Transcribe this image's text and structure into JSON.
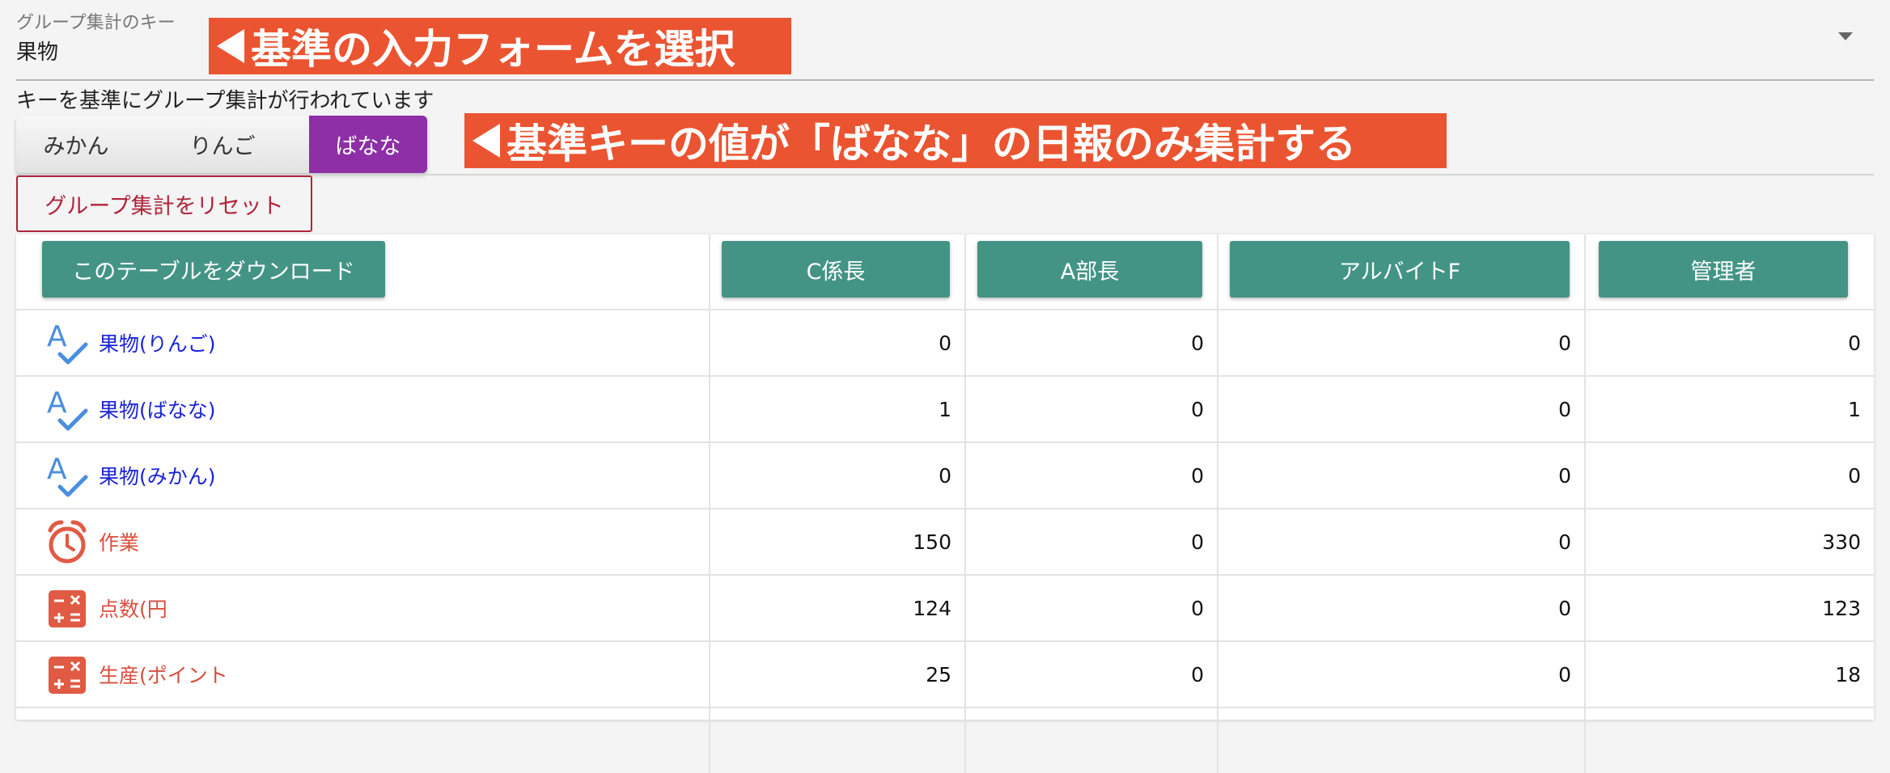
{
  "key_select": {
    "caption": "グループ集計のキー",
    "value": "果物"
  },
  "annotations": {
    "select_form": "基準の入力フォームを選択",
    "banana_only": "基準キーの値が「ばなな」の日報のみ集計する"
  },
  "hint": "キーを基準にグループ集計が行われています",
  "toggles": [
    {
      "label": "みかん",
      "active": false
    },
    {
      "label": "りんご",
      "active": false
    },
    {
      "label": "ばなな",
      "active": true
    }
  ],
  "reset_label": "グループ集計をリセット",
  "table": {
    "download_label": "このテーブルをダウンロード",
    "columns": [
      "C係長",
      "A部長",
      "アルバイトF",
      "管理者"
    ],
    "rows": [
      {
        "label": "果物(りんご)",
        "icon": "spellcheck-icon",
        "values": [
          "0",
          "0",
          "0",
          "0"
        ]
      },
      {
        "label": "果物(ばなな)",
        "icon": "spellcheck-icon",
        "values": [
          "1",
          "0",
          "0",
          "1"
        ]
      },
      {
        "label": "果物(みかん)",
        "icon": "spellcheck-icon",
        "values": [
          "0",
          "0",
          "0",
          "0"
        ]
      },
      {
        "label": "作業",
        "icon": "alarm-clock-icon",
        "values": [
          "150",
          "0",
          "0",
          "330"
        ]
      },
      {
        "label": "点数(円",
        "icon": "calculator-icon",
        "values": [
          "124",
          "0",
          "0",
          "123"
        ]
      },
      {
        "label": "生産(ポイント",
        "icon": "calculator-icon",
        "values": [
          "25",
          "0",
          "0",
          "18"
        ]
      }
    ]
  },
  "colors": {
    "annotation": "#eb5431",
    "active_toggle": "#8e2fa7",
    "teal_button": "#449486",
    "reset_border": "#b0253b",
    "text_link": "#1a24d8",
    "text_red": "#d94f3c"
  }
}
